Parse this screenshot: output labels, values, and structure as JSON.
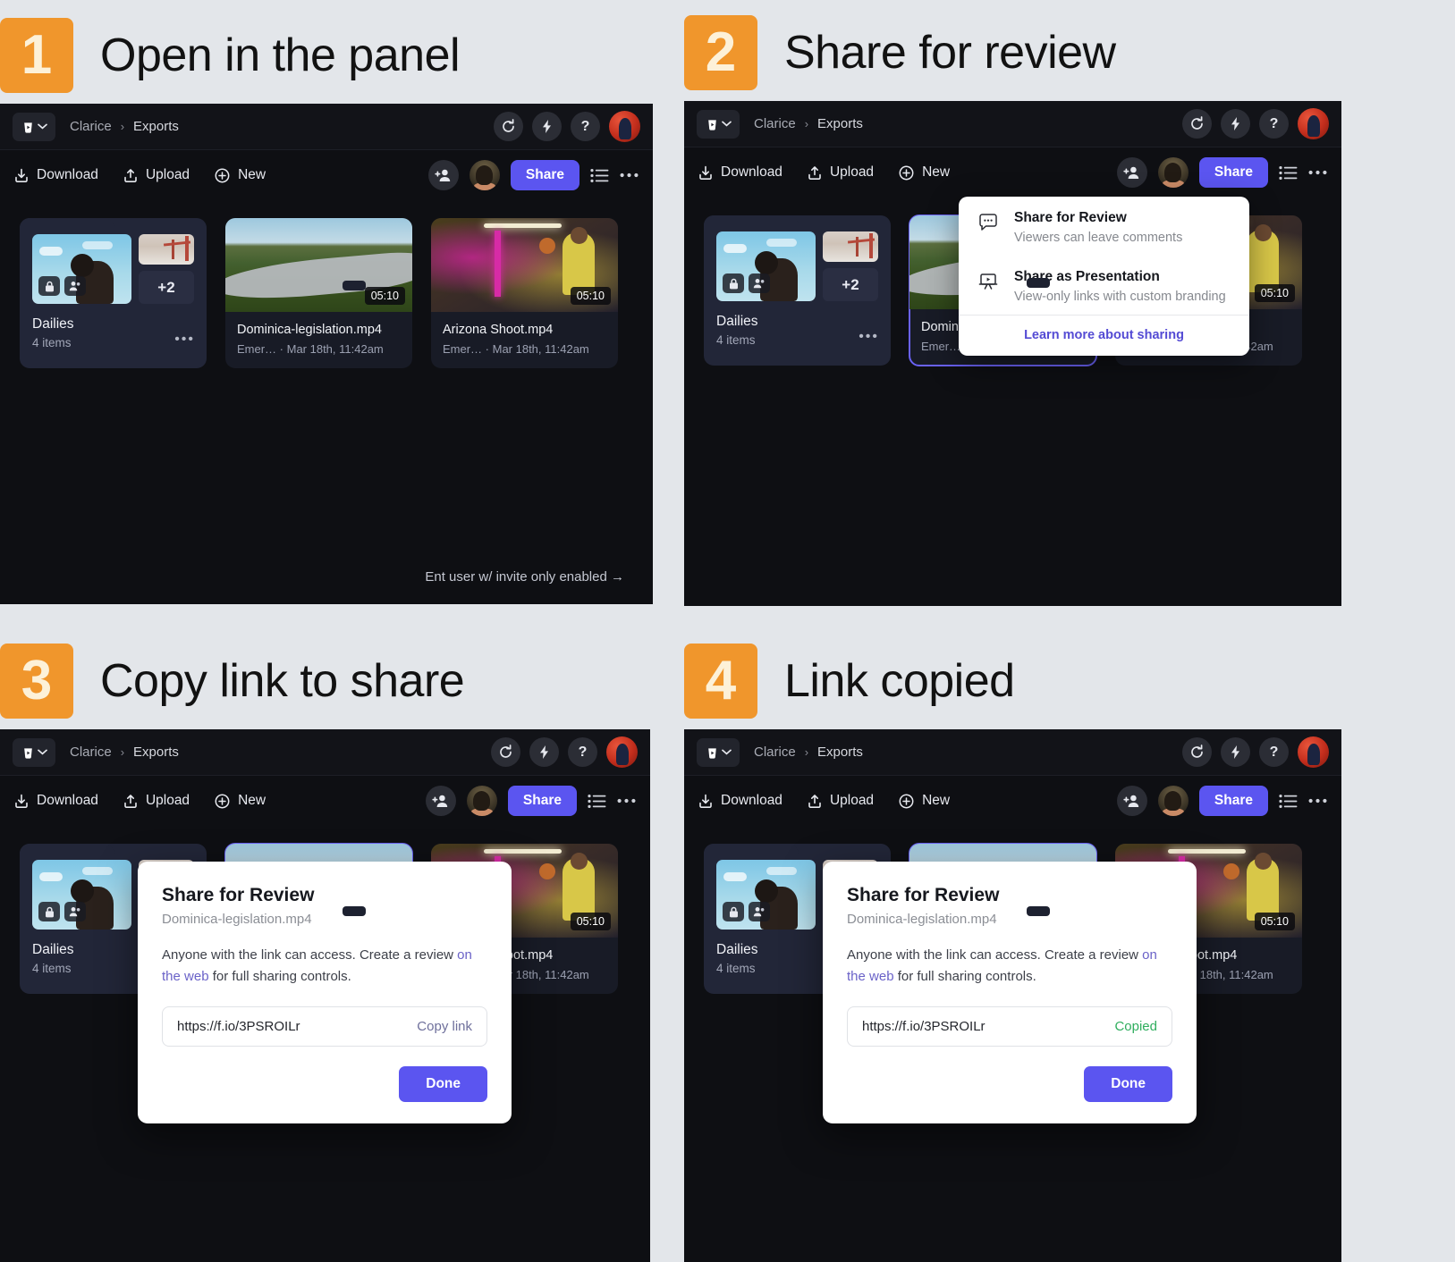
{
  "steps": [
    {
      "number": "1",
      "title": "Open in the panel"
    },
    {
      "number": "2",
      "title": "Share for review"
    },
    {
      "number": "3",
      "title": "Copy link to share"
    },
    {
      "number": "4",
      "title": "Link copied"
    }
  ],
  "app": {
    "breadcrumb": {
      "root": "Clarice",
      "separator": "›",
      "current": "Exports"
    },
    "topbar_icons": [
      "cup-icon",
      "chevron-down-icon",
      "refresh-icon",
      "lightning-icon",
      "help-icon",
      "user-avatar"
    ],
    "toolbar": {
      "download_label": "Download",
      "upload_label": "Upload",
      "new_label": "New",
      "share_label": "Share",
      "add_person_icon": "add-person-icon",
      "list_view_icon": "list-view-icon",
      "more_icon": "more-horizontal-icon"
    },
    "cards": {
      "folder": {
        "name": "Dailies",
        "subtitle": "4 items",
        "overflow_count": "+2",
        "badges": [
          "lock-icon",
          "shared-people-icon"
        ]
      },
      "video1": {
        "name": "Dominica-legislation.mp4",
        "subtitle": "Emer… · Mar 18th, 11:42am",
        "duration": "05:10"
      },
      "video2": {
        "name": "Arizona Shoot.mp4",
        "subtitle": "Emer… · Mar 18th, 11:42am",
        "duration": "05:10"
      }
    },
    "hint": "Ent user w/ invite only enabled →"
  },
  "share_menu": {
    "items": [
      {
        "icon": "comment-bubble-icon",
        "title": "Share for Review",
        "desc": "Viewers can leave comments"
      },
      {
        "icon": "presentation-icon",
        "title": "Share as Presentation",
        "desc": "View-only links with custom branding"
      }
    ],
    "footer_link": "Learn more about sharing"
  },
  "share_dialog": {
    "title": "Share for Review",
    "filename": "Dominica-legislation.mp4",
    "body_part1": "Anyone with the link can access. Create a review ",
    "body_link": "on the web",
    "body_part2": " for full sharing controls.",
    "url": "https://f.io/3PSROILr",
    "copy_action": "Copy link",
    "copied_action": "Copied",
    "done_label": "Done"
  },
  "colors": {
    "page_bg": "#e3e6ea",
    "badge_orange": "#f0962c",
    "accent_purple": "#5b55f0",
    "app_bg": "#0e0f13",
    "copied_green": "#2fae5e"
  }
}
